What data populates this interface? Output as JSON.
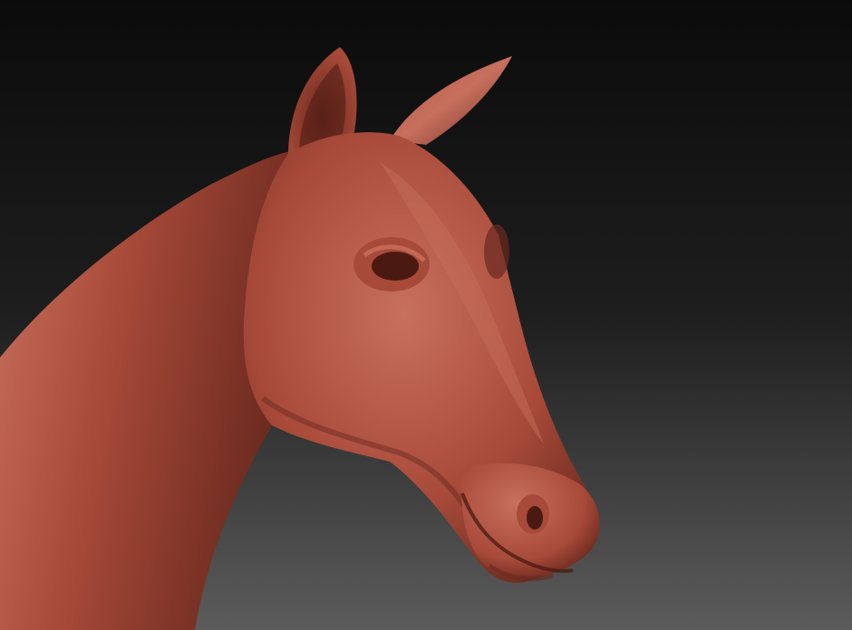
{
  "scene": {
    "subject": "horse-head-sculpt",
    "colors": {
      "background_top": "#0b0b0b",
      "background_mid": "#1e1e1e",
      "background_bottom": "#5c5c5c",
      "clay_base": "#a84a39",
      "clay_light": "#c8705e",
      "clay_shadow": "#6b2a1f",
      "clay_deep": "#4a1a12"
    }
  }
}
